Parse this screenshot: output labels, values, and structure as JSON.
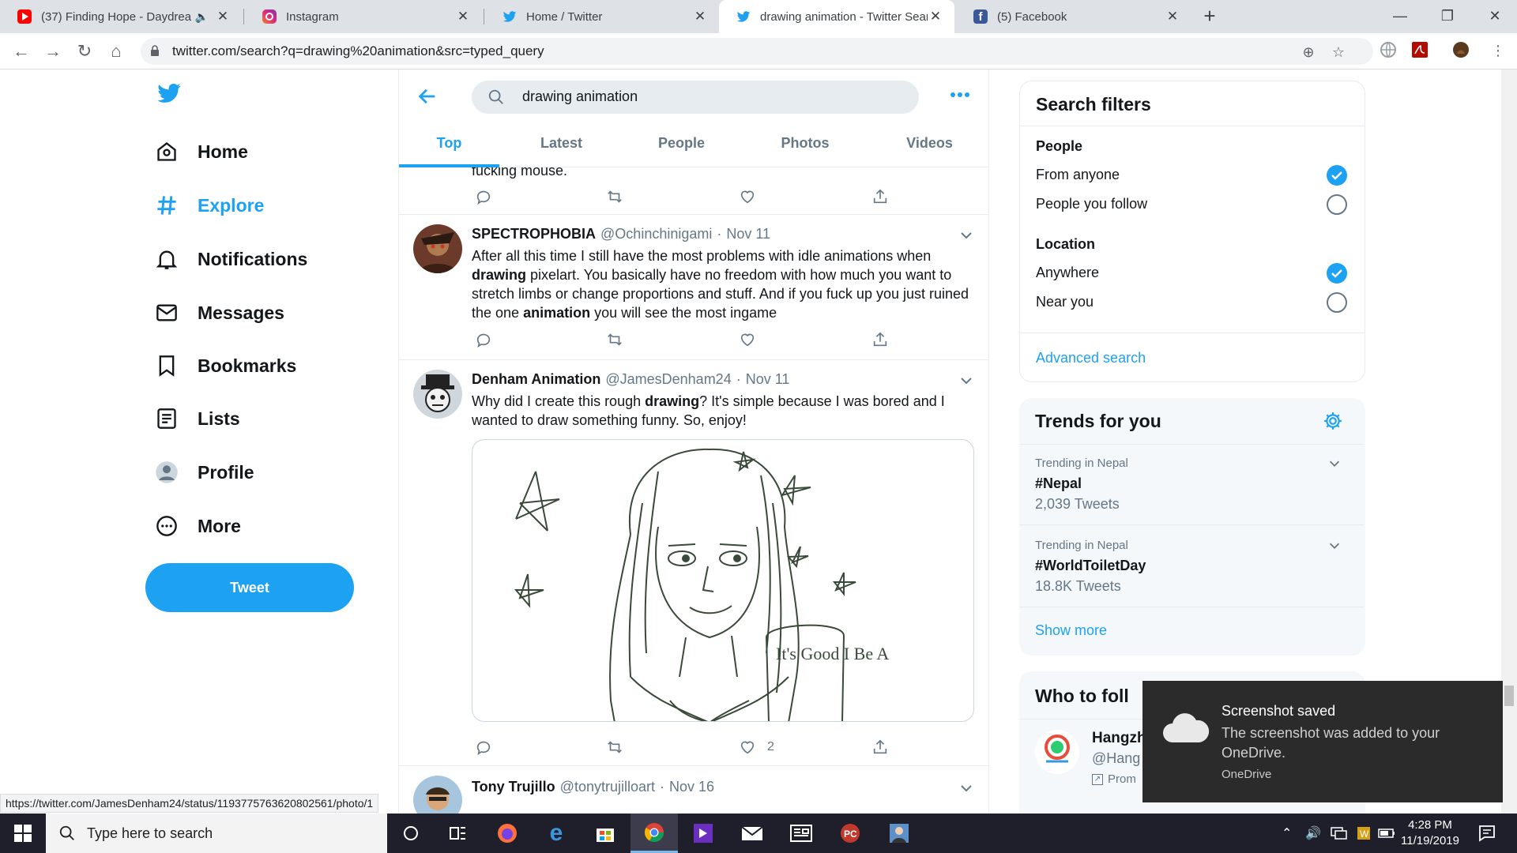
{
  "browser": {
    "tabs": [
      {
        "title": "(37) Finding Hope - Daydrea",
        "favicon": "youtube-icon",
        "color": "#ff0000"
      },
      {
        "title": "Instagram",
        "favicon": "instagram-icon",
        "color": "#c13584"
      },
      {
        "title": "Home / Twitter",
        "favicon": "twitter-icon",
        "color": "#1da1f2"
      },
      {
        "title": "drawing animation - Twitter Sear",
        "favicon": "twitter-icon",
        "color": "#1da1f2"
      },
      {
        "title": "(5) Facebook",
        "favicon": "facebook-icon",
        "color": "#3b5998"
      }
    ],
    "active_tab": 3,
    "url": "twitter.com/search?q=drawing%20animation&src=typed_query",
    "status_url": "https://twitter.com/JamesDenham24/status/1193775763620802561/photo/1"
  },
  "nav": {
    "items": [
      {
        "label": "Home",
        "icon": "home-icon"
      },
      {
        "label": "Explore",
        "icon": "hashtag-icon"
      },
      {
        "label": "Notifications",
        "icon": "bell-icon"
      },
      {
        "label": "Messages",
        "icon": "envelope-icon"
      },
      {
        "label": "Bookmarks",
        "icon": "bookmark-icon"
      },
      {
        "label": "Lists",
        "icon": "list-icon"
      },
      {
        "label": "Profile",
        "icon": "profile-icon"
      },
      {
        "label": "More",
        "icon": "more-circle-icon"
      }
    ],
    "active": "Explore",
    "tweet_button": "Tweet"
  },
  "search": {
    "query": "drawing animation",
    "tabs": [
      "Top",
      "Latest",
      "People",
      "Photos",
      "Videos"
    ],
    "active_tab": "Top"
  },
  "feed": {
    "fragment_text": "fucking mouse.",
    "tweets": [
      {
        "name": "SPECTROPHOBIA",
        "handle": "@Ochinchinigami",
        "date": "Nov 11",
        "body_html": "After all this time I still have the most problems with idle animations when <b>drawing</b> pixelart. You basically have no freedom with how much you want to stretch limbs or change proportions and stuff. And if you fuck up you just ruined the one <b>animation</b> you will see the most ingame",
        "likes": ""
      },
      {
        "name": "Denham Animation",
        "handle": "@JamesDenham24",
        "date": "Nov 11",
        "body_html": "Why did I create this rough <b>drawing</b>? It's simple because I was bored and I wanted to draw something funny. So, enjoy!",
        "likes": "2",
        "media_caption": "It's Good I Be A"
      },
      {
        "name": "Tony Trujillo",
        "handle": "@tonytrujilloart",
        "date": "Nov 16"
      }
    ]
  },
  "filters": {
    "title": "Search filters",
    "people_heading": "People",
    "people_options": [
      "From anyone",
      "People you follow"
    ],
    "location_heading": "Location",
    "location_options": [
      "Anywhere",
      "Near you"
    ],
    "advanced": "Advanced search"
  },
  "trends": {
    "title": "Trends for you",
    "items": [
      {
        "context": "Trending in Nepal",
        "name": "#Nepal",
        "count": "2,039 Tweets"
      },
      {
        "context": "Trending in Nepal",
        "name": "#WorldToiletDay",
        "count": "18.8K Tweets"
      }
    ],
    "show_more": "Show more"
  },
  "who_to_follow": {
    "title": "Who to foll",
    "name": "Hangzh",
    "handle": "@Hang",
    "promoted": "Prom"
  },
  "toast": {
    "title": "Screenshot saved",
    "message": "The screenshot was added to your OneDrive.",
    "source": "OneDrive"
  },
  "taskbar": {
    "search_placeholder": "Type here to search",
    "time": "4:28 PM",
    "date": "11/19/2019"
  },
  "colors": {
    "twitter_blue": "#1da1f2",
    "text": "#14171a",
    "secondary": "#657786"
  }
}
